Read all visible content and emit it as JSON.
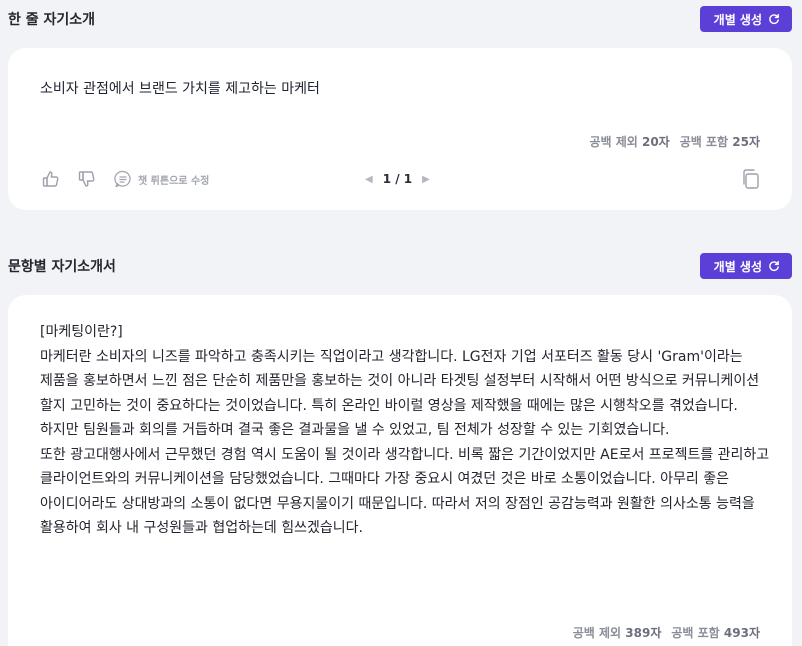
{
  "oneline": {
    "title": "한 줄 자기소개",
    "generate_label": "개별 생성",
    "text": "소비자 관점에서 브랜드 가치를 제고하는 마케터",
    "count_excl_label": "공백 제외",
    "count_excl_value": "20자",
    "count_incl_label": "공백 포함",
    "count_incl_value": "25자",
    "chat_edit_label": "챗 뤼튼으로 수정",
    "page_indicator": "1 / 1"
  },
  "essay": {
    "title": "문항별 자기소개서",
    "generate_label": "개별 생성",
    "text": "[마케팅이란?]\n마케터란 소비자의 니즈를 파악하고 충족시키는 직업이라고 생각합니다. LG전자 기업 서포터즈 활동 당시 'Gram'이라는 제품을 홍보하면서 느낀 점은 단순히 제품만을 홍보하는 것이 아니라 타겟팅 설정부터 시작해서 어떤 방식으로 커뮤니케이션 할지 고민하는 것이 중요하다는 것이었습니다. 특히 온라인 바이럴 영상을 제작했을 때에는 많은 시행착오를 겪었습니다. 하지만 팀원들과 회의를 거듭하며 결국 좋은 결과물을 낼 수 있었고, 팀 전체가 성장할 수 있는 기회였습니다.\n또한 광고대행사에서 근무했던 경험 역시 도움이 될 것이라 생각합니다. 비록 짧은 기간이었지만 AE로서 프로젝트를 관리하고 클라이언트와의 커뮤니케이션을 담당했었습니다. 그때마다 가장 중요시 여겼던 것은 바로 소통이었습니다. 아무리 좋은 아이디어라도 상대방과의 소통이 없다면 무용지물이기 때문입니다. 따라서 저의 장점인 공감능력과 원활한 의사소통 능력을 활용하여 회사 내 구성원들과 협업하는데 힘쓰겠습니다.",
    "count_excl_label": "공백 제외",
    "count_excl_value": "389자",
    "count_incl_label": "공백 포함",
    "count_incl_value": "493자"
  },
  "colors": {
    "accent": "#5b3fd6",
    "background": "#f2f3f6",
    "card": "#ffffff",
    "muted_text": "#8a8d99"
  },
  "icons": [
    "refresh-icon",
    "thumbs-up-icon",
    "thumbs-down-icon",
    "chat-bubble-icon",
    "prev-arrow-icon",
    "next-arrow-icon",
    "copy-icon"
  ]
}
